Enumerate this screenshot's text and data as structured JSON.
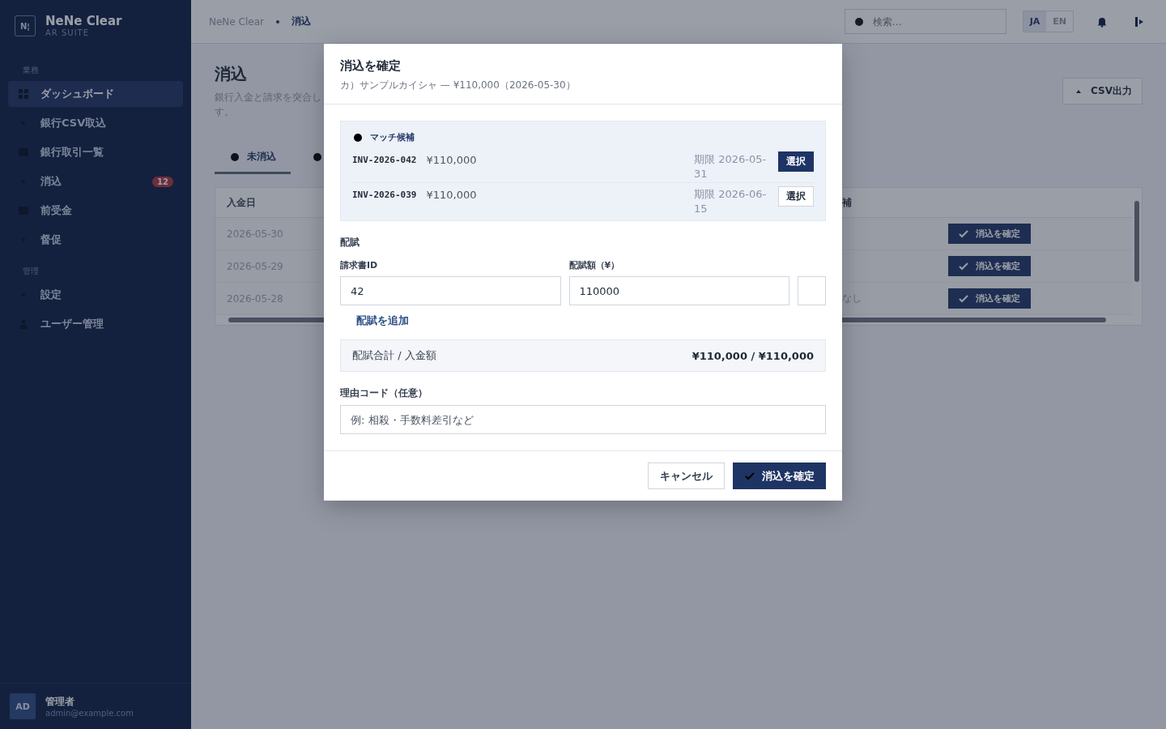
{
  "sidebar": {
    "brand": {
      "logo": "N¦",
      "name": "NeNe Clear",
      "subtitle": "AR SUITE"
    },
    "sections": [
      {
        "title": "業務",
        "items": [
          {
            "label": "ダッシュボード",
            "kind": "grid",
            "selected": true
          },
          {
            "label": "銀行CSV取込",
            "kind": "dot",
            "selected": false
          },
          {
            "label": "銀行取引一覧",
            "kind": "square",
            "selected": false
          },
          {
            "label": "消込",
            "kind": "dot",
            "selected": false,
            "badge": "12"
          },
          {
            "label": "前受金",
            "kind": "square",
            "selected": false
          },
          {
            "label": "督促",
            "kind": "dot",
            "selected": false
          }
        ]
      },
      {
        "title": "管理",
        "items": [
          {
            "label": "設定",
            "kind": "dot",
            "selected": false
          },
          {
            "label": "ユーザー管理",
            "kind": "person",
            "selected": false
          }
        ]
      }
    ],
    "user": {
      "initials": "AD",
      "name": "管理者",
      "email": "admin@example.com"
    }
  },
  "topbar": {
    "breadcrumb": [
      "NeNe Clear",
      "消込"
    ],
    "search": {
      "placeholder": "検索…"
    },
    "languages": [
      {
        "label": "JA",
        "selected": true
      },
      {
        "label": "EN",
        "selected": false
      }
    ]
  },
  "page": {
    "title": "消込",
    "description": [
      "銀行入金と請求を突合し",
      "す。"
    ],
    "export_button": "CSV出力",
    "tabs": [
      {
        "label": "未消込",
        "selected": true
      },
      {
        "selected": false
      }
    ],
    "table": {
      "columns": [
        "入金日",
        "補",
        ""
      ],
      "rows": [
        {
          "date": "2026-05-30",
          "action": "消込を確定"
        },
        {
          "date": "2026-05-29",
          "action": "消込を確定"
        },
        {
          "date": "2026-05-28",
          "candidate": "なし",
          "action": "消込を確定"
        }
      ]
    }
  },
  "dialog": {
    "title": "消込を確定",
    "subtitle": "カ）サンプルカイシャ — ¥110,000（2026-05-30）",
    "candidates": {
      "title": "マッチ候補",
      "items": [
        {
          "invoice": "INV-2026-042",
          "amount": "¥110,000",
          "due": "期限 2026-05-31",
          "button": "選択",
          "selected": true
        },
        {
          "invoice": "INV-2026-039",
          "amount": "¥110,000",
          "due": "期限 2026-06-15",
          "button": "選択",
          "selected": false
        }
      ]
    },
    "allocation": {
      "title": "配賦",
      "invoice_label": "請求書ID",
      "amount_label": "配賦額（¥）",
      "invoice_value": "42",
      "amount_value": "110000",
      "add_link": "配賦を追加"
    },
    "summary": {
      "label": "配賦合計 / 入金額",
      "value": "¥110,000 / ¥110,000"
    },
    "reason": {
      "label": "理由コード（任意）",
      "placeholder": "例: 相殺・手数料差引など"
    },
    "buttons": {
      "cancel": "キャンセル",
      "confirm": "消込を確定"
    }
  }
}
